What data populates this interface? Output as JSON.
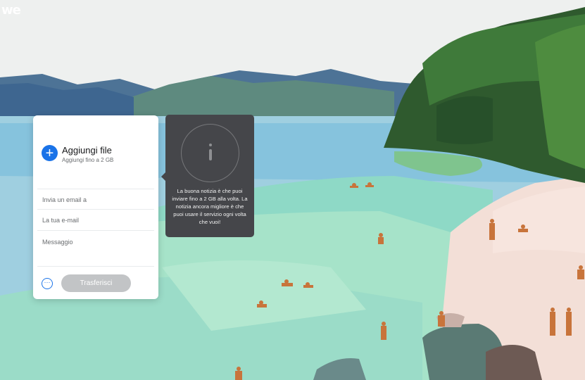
{
  "brand": {
    "logo_text": "we"
  },
  "transfer_panel": {
    "add_title": "Aggiungi file",
    "add_subtitle": "Aggiungi fino a 2 GB",
    "add_icon": "plus-icon",
    "fields": {
      "recipient_placeholder": "Invia un email a",
      "sender_placeholder": "La tua e-mail",
      "message_placeholder": "Messaggio"
    },
    "more_icon": "more-options-icon",
    "transfer_label": "Trasferisci"
  },
  "info_tooltip": {
    "icon": "info-icon",
    "text": "La buona notizia è che puoi inviare fino a 2 GB alla volta. La notizia ancora migliore è che puoi usare il servizio ogni volta che vuoi!"
  },
  "colors": {
    "accent": "#1a73e8",
    "tooltip_bg": "#45464a",
    "disabled_button": "#c2c4c6"
  }
}
